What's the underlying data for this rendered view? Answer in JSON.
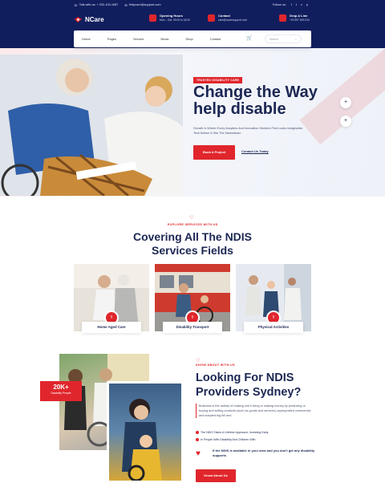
{
  "topbar": {
    "talk": "Talk with us: + 202-100-1087",
    "email": "Helpcare@support.com",
    "follow": "Follow us:",
    "social": [
      "f",
      "t",
      "v",
      "p"
    ]
  },
  "header": {
    "logo_text": "NCare",
    "opening": {
      "title": "Opening Hours",
      "detail": "Mon – Sat: 09:00 to 18:00"
    },
    "contact": {
      "title": "Contact",
      "detail": "care@ncaresupport.com"
    },
    "drop": {
      "title": "Drop A Line",
      "detail": "+00 897 893 034"
    }
  },
  "nav": {
    "items": [
      "Home",
      "Pages",
      "Service",
      "News",
      "Shop",
      "Contact"
    ],
    "search_placeholder": "Search"
  },
  "hero": {
    "badge": "TRUSTED DISABILITY CARE",
    "title": "Change the Way help disable",
    "text": "Growth Is Where Every Adopters And Innovation Seekers Find Looks Imaginative Tech Before It Hits The Mainstream",
    "primary_btn": "Book A Project",
    "link": "Contact Us Today"
  },
  "services": {
    "subtitle": "EXPLORE SERVICES WITH US",
    "title": "Covering All The NDIS Services Fields",
    "cards": [
      {
        "label": "Home Aged Care"
      },
      {
        "label": "Disability Transport"
      },
      {
        "label": "Physical Activities"
      }
    ]
  },
  "about": {
    "subtitle": "KNOW ABOUT WITH US",
    "title": "Looking For NDIS Providers Sydney?",
    "text": "Business is the activity of making one's living or making money by producing or buying and selling products (such as goods and services) appropriated commercial and adopted big bill and.",
    "checks": [
      "The NDIS Takes A Lifetime Approach, Investing Early",
      "In People With Disability And Children With"
    ],
    "note": "If the NDIS is available in your area and you don't get any disability supports",
    "button": "Know About Us",
    "stat_num": "20K+",
    "stat_label": "Disability People"
  },
  "colors": {
    "navy": "#111e5e",
    "accent": "#e0262c"
  }
}
